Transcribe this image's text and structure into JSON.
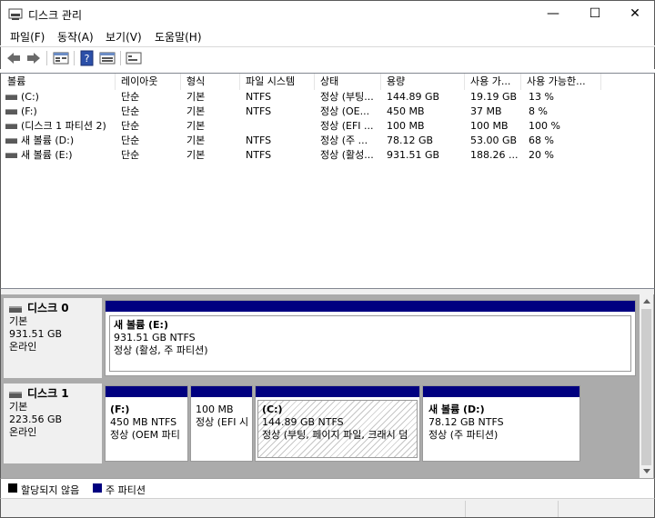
{
  "window": {
    "title": "디스크 관리",
    "min_glyph": "—",
    "max_glyph": "☐",
    "close_glyph": "✕"
  },
  "menu": [
    "파일(F)",
    "동작(A)",
    "보기(V)",
    "도움말(H)"
  ],
  "toolbar": {
    "icons": [
      "back-icon",
      "forward-icon",
      "disk-list-view-icon",
      "help-icon",
      "properties-view-icon",
      "console-icon"
    ]
  },
  "volume_list": {
    "columns": [
      "볼륨",
      "레이아웃",
      "형식",
      "파일 시스템",
      "상태",
      "용량",
      "사용 가...",
      "사용 가능한..."
    ],
    "rows": [
      {
        "volume": "(C:)",
        "layout": "단순",
        "type": "기본",
        "fs": "NTFS",
        "status": "정상 (부팅...",
        "capacity": "144.89 GB",
        "free": "19.19 GB",
        "pct": "13 %"
      },
      {
        "volume": "(F:)",
        "layout": "단순",
        "type": "기본",
        "fs": "NTFS",
        "status": "정상 (OE...",
        "capacity": "450 MB",
        "free": "37 MB",
        "pct": "8 %"
      },
      {
        "volume": "(디스크 1 파티션 2)",
        "layout": "단순",
        "type": "기본",
        "fs": "",
        "status": "정상 (EFI ...",
        "capacity": "100 MB",
        "free": "100 MB",
        "pct": "100 %"
      },
      {
        "volume": "새 볼륨 (D:)",
        "layout": "단순",
        "type": "기본",
        "fs": "NTFS",
        "status": "정상 (주 ...",
        "capacity": "78.12 GB",
        "free": "53.00 GB",
        "pct": "68 %"
      },
      {
        "volume": "새 볼륨 (E:)",
        "layout": "단순",
        "type": "기본",
        "fs": "NTFS",
        "status": "정상 (활성...",
        "capacity": "931.51 GB",
        "free": "188.26 ...",
        "pct": "20 %"
      }
    ]
  },
  "disks": [
    {
      "name": "디스크 0",
      "type": "기본",
      "size": "931.51 GB",
      "state": "온라인",
      "partitions": [
        {
          "title": "새 볼륨  (E:)",
          "size": "931.51 GB NTFS",
          "status": "정상 (활성, 주 파티션)"
        }
      ]
    },
    {
      "name": "디스크 1",
      "type": "기본",
      "size": "223.56 GB",
      "state": "온라인",
      "partitions": [
        {
          "title": "(F:)",
          "size": "450 MB NTFS",
          "status": "정상 (OEM 파티"
        },
        {
          "title": "",
          "size": "100 MB",
          "status": "정상 (EFI 시"
        },
        {
          "title": "(C:)",
          "size": "144.89 GB NTFS",
          "status": "정상 (부팅, 페이지 파일, 크래시 덤"
        },
        {
          "title": "새 볼륨  (D:)",
          "size": "78.12 GB NTFS",
          "status": "정상 (주 파티션)"
        }
      ]
    }
  ],
  "legend": [
    {
      "label": "할당되지 않음",
      "color": "#000000"
    },
    {
      "label": "주 파티션",
      "color": "#000080"
    }
  ],
  "colors": {
    "primary_partition": "#000080",
    "unallocated": "#000000"
  }
}
